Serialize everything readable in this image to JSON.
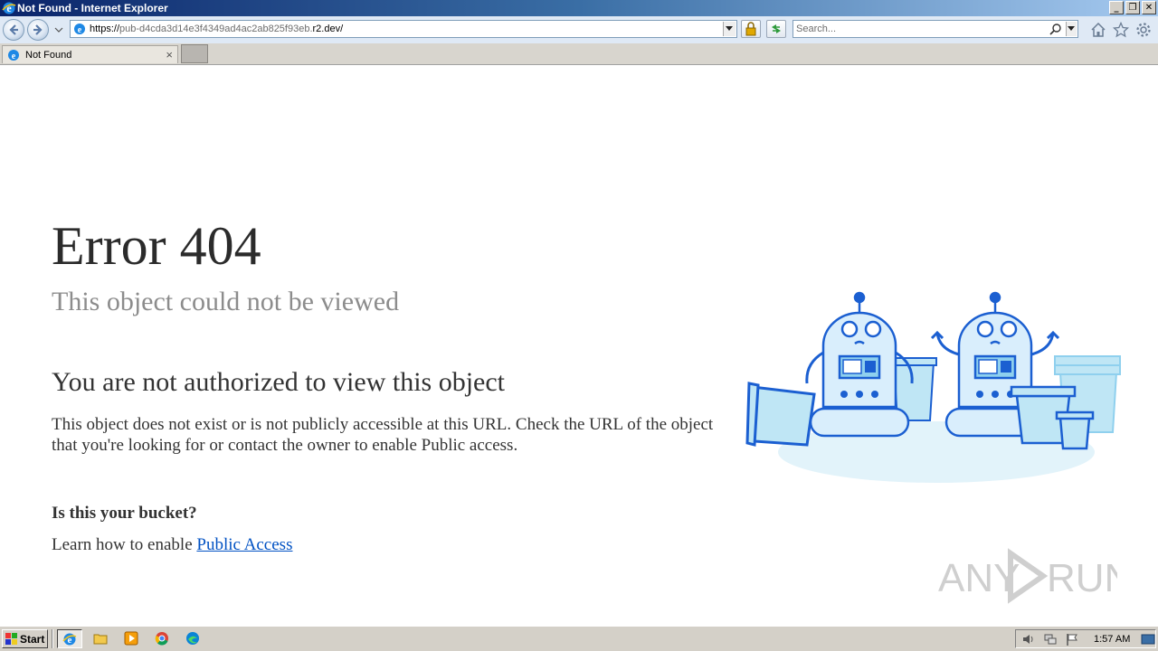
{
  "window": {
    "title": "Not Found - Internet Explorer",
    "minimize_glyph": "_",
    "restore_glyph": "❐",
    "close_glyph": "✕"
  },
  "address_bar": {
    "url_prefix": "https://",
    "url_host_gray": "pub-d4cda3d14e3f4349ad4ac2ab825f93eb.",
    "url_host_dark": "r2.dev",
    "url_path": "/"
  },
  "search": {
    "placeholder": "Search..."
  },
  "tabs": [
    {
      "label": "Not Found",
      "close_glyph": "×"
    }
  ],
  "page": {
    "title": "Error 404",
    "subtitle": "This object could not be viewed",
    "heading": "You are not authorized to view this object",
    "body": "This object does not exist or is not publicly accessible at this URL. Check the URL of the object that you're looking for or contact the owner to enable Public access.",
    "bucket_question": "Is this your bucket?",
    "learn_prefix": "Learn how to enable ",
    "learn_link": "Public Access"
  },
  "watermark": {
    "text_left": "ANY",
    "text_right": "RUN"
  },
  "taskbar": {
    "start_label": "Start",
    "clock": "1:57 AM"
  },
  "colors": {
    "link": "#0051c3",
    "robot_blue": "#1b5fd1",
    "robot_fill": "#d9eefc",
    "pot_fill": "#bfe6f5",
    "shadow": "#e2f3fa"
  }
}
